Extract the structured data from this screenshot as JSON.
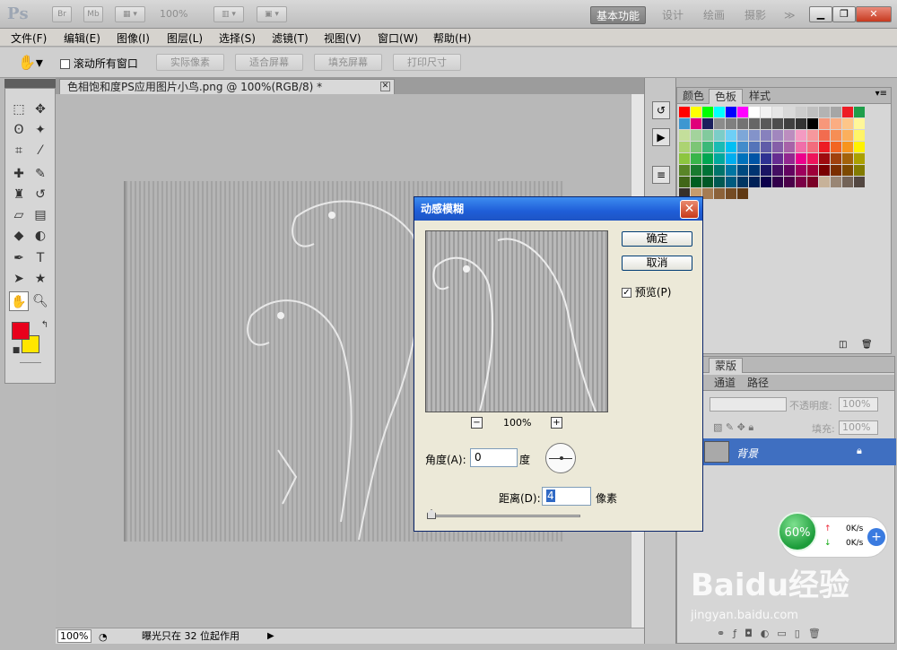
{
  "app": {
    "logo": "Ps",
    "top_buttons": [
      "Br",
      "Mb"
    ],
    "zoom_display": "100%",
    "workspaces": [
      "基本功能",
      "设计",
      "绘画",
      "摄影"
    ],
    "more": "≫"
  },
  "menubar": {
    "items": [
      "文件(F)",
      "编辑(E)",
      "图像(I)",
      "图层(L)",
      "选择(S)",
      "滤镜(T)",
      "视图(V)",
      "窗口(W)",
      "帮助(H)"
    ]
  },
  "options": {
    "scroll_all_label": "滚动所有窗口",
    "buttons": [
      "实际像素",
      "适合屏幕",
      "填充屏幕",
      "打印尺寸"
    ]
  },
  "document": {
    "tab_title": "色相饱和度PS应用图片小鸟.png @ 100%(RGB/8) *",
    "status_zoom": "100%",
    "status_text": "曝光只在 32 位起作用"
  },
  "swatches_panel": {
    "tabs": [
      "颜色",
      "色板",
      "样式"
    ],
    "active_tab": "色板",
    "colors": [
      "#ff0000",
      "#ffff00",
      "#00ff00",
      "#00ffff",
      "#0000ff",
      "#ff00ff",
      "#ffffff",
      "#f2f2f2",
      "#e6e6e6",
      "#d9d9d9",
      "#cccccc",
      "#bfbfbf",
      "#b3b3b3",
      "#a6a6a6",
      "#ed1c24",
      "#1f9e4a",
      "#3e97d1",
      "#e0007a",
      "#1b1f5d",
      "#8c8c8c",
      "#808080",
      "#737373",
      "#666666",
      "#595959",
      "#4d4d4d",
      "#404040",
      "#333333",
      "#000000",
      "#f7977a",
      "#fbad82",
      "#fdc689",
      "#fff799",
      "#c4df9b",
      "#a3d39c",
      "#82ca9d",
      "#7bcdc8",
      "#6ecff6",
      "#7da7d8",
      "#8393ca",
      "#8781bd",
      "#a187be",
      "#bc8dbf",
      "#f49ac2",
      "#f6989d",
      "#f26c4f",
      "#f68e55",
      "#fbaf5c",
      "#fff467",
      "#acd372",
      "#7cc576",
      "#3bb878",
      "#1abbb4",
      "#00bff3",
      "#438ccb",
      "#5574b9",
      "#605ca8",
      "#855fa8",
      "#a763a8",
      "#f06ea9",
      "#f26d7d",
      "#ed1c24",
      "#f26522",
      "#f7941d",
      "#fff200",
      "#8dc63f",
      "#39b54a",
      "#00a651",
      "#00a99d",
      "#00aeef",
      "#0072bc",
      "#0054a6",
      "#2e3192",
      "#662d91",
      "#92278f",
      "#ec008c",
      "#ed145b",
      "#9e0b0f",
      "#a0410d",
      "#a3620a",
      "#aba000",
      "#598527",
      "#197b30",
      "#007236",
      "#00746b",
      "#0076a3",
      "#004a80",
      "#003471",
      "#1b1464",
      "#440e62",
      "#630460",
      "#9e005d",
      "#9e0039",
      "#790000",
      "#7b2e00",
      "#7d4900",
      "#827b00",
      "#406618",
      "#005e20",
      "#005826",
      "#005952",
      "#005b7f",
      "#003663",
      "#002157",
      "#0d004c",
      "#32004b",
      "#4b0049",
      "#7b0046",
      "#7a0026",
      "#c7b299",
      "#998675",
      "#736357",
      "#534741",
      "#37302a",
      "#c69c6d",
      "#a67c52",
      "#8c6239",
      "#754c24",
      "#603913"
    ]
  },
  "layers_panel": {
    "masks_tab": "蒙版",
    "tabs": [
      "通道",
      "路径"
    ],
    "opacity_label": "不透明度:",
    "opacity_value": "100%",
    "fill_label": "填充:",
    "fill_value": "100%",
    "layer_name": "背景"
  },
  "network_widget": {
    "percent": "60%",
    "up": "0K/s",
    "down": "0K/s"
  },
  "dialog": {
    "title": "动感模糊",
    "ok": "确定",
    "cancel": "取消",
    "preview_label": "预览(P)",
    "preview_checked": true,
    "preview_zoom": "100%",
    "minus": "−",
    "plus": "+",
    "angle_label": "角度(A):",
    "angle_value": "0",
    "angle_unit": "度",
    "distance_label": "距离(D):",
    "distance_value": "4",
    "distance_unit": "像素"
  },
  "watermark": {
    "brand": "Baidu经验",
    "url": "jingyan.baidu.com"
  }
}
